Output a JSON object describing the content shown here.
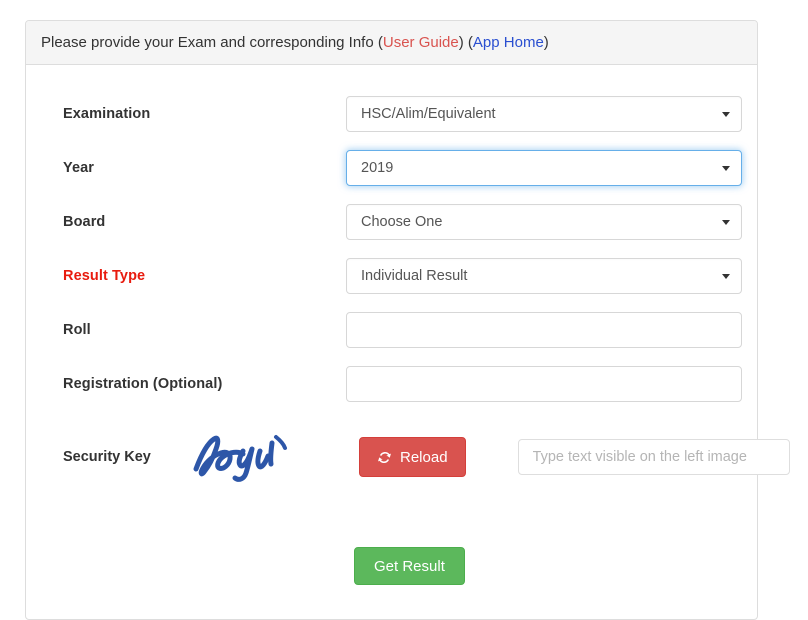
{
  "panel": {
    "heading": {
      "text_before": "Please provide your Exam and corresponding Info ",
      "user_guide_label": "User Guide",
      "app_home_label": "App Home",
      "open_paren": "(",
      "close_paren": ")",
      "space": " "
    }
  },
  "form": {
    "examination": {
      "label": "Examination",
      "value": "HSC/Alim/Equivalent"
    },
    "year": {
      "label": "Year",
      "value": "2019"
    },
    "board": {
      "label": "Board",
      "value": "Choose One"
    },
    "result_type": {
      "label": "Result Type",
      "value": "Individual Result"
    },
    "roll": {
      "label": "Roll",
      "value": "",
      "placeholder": ""
    },
    "registration": {
      "label": "Registration (Optional)",
      "value": "",
      "placeholder": ""
    },
    "security_key": {
      "label": "Security Key",
      "captcha_text": "haeyi",
      "reload_label": "Reload",
      "reload_icon": "refresh-icon",
      "input_value": "",
      "input_placeholder": "Type text visible on the left image"
    },
    "submit": {
      "label": "Get Result"
    }
  },
  "colors": {
    "danger": "#d9534f",
    "required_label": "#e81b0e",
    "link_blue": "#2a4fd0",
    "success": "#5cb85c",
    "captcha_ink": "#2d56a8",
    "focus_ring": "#66afe9"
  }
}
